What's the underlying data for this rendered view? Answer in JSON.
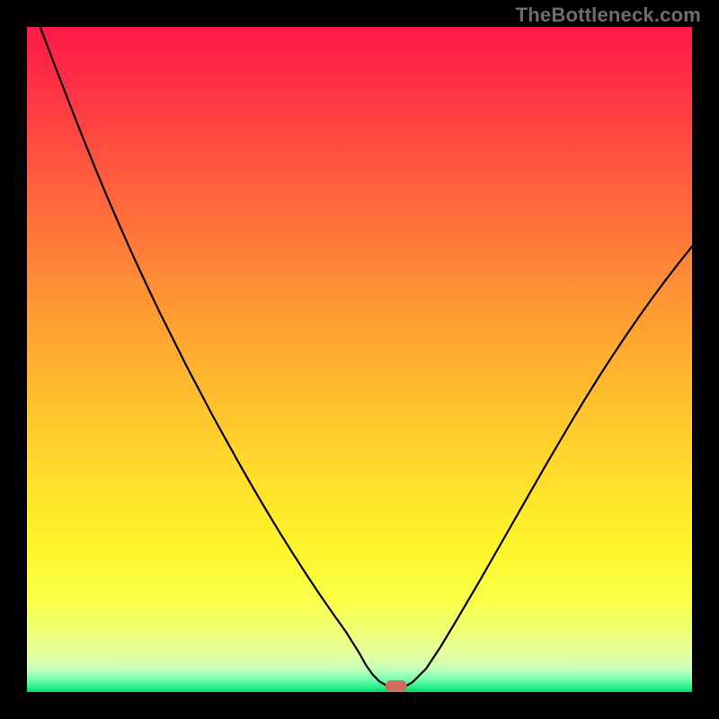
{
  "watermark": "TheBottleneck.com",
  "chart_data": {
    "type": "line",
    "title": "",
    "xlabel": "",
    "ylabel": "",
    "xlim": [
      0,
      100
    ],
    "ylim": [
      0,
      100
    ],
    "x": [
      0,
      2,
      4,
      6,
      8,
      10,
      12,
      14,
      16,
      18,
      20,
      22,
      24,
      26,
      28,
      30,
      32,
      34,
      36,
      38,
      40,
      42,
      44,
      46,
      48,
      50,
      51,
      52,
      53,
      54,
      55,
      56,
      57,
      58,
      60,
      62,
      64,
      66,
      68,
      70,
      72,
      74,
      76,
      78,
      80,
      82,
      84,
      86,
      88,
      90,
      92,
      94,
      96,
      98,
      100
    ],
    "values": [
      null,
      100,
      94.7,
      89.5,
      84.4,
      79.4,
      74.6,
      70.0,
      65.5,
      61.2,
      57.0,
      53.0,
      49.0,
      45.2,
      41.4,
      37.8,
      34.2,
      30.7,
      27.3,
      24.0,
      20.8,
      17.7,
      14.7,
      11.8,
      9.0,
      5.8,
      4.0,
      2.6,
      1.6,
      1.0,
      0.9,
      0.9,
      0.9,
      1.5,
      3.5,
      6.5,
      9.8,
      13.2,
      16.6,
      20.1,
      23.6,
      27.1,
      30.6,
      34.1,
      37.5,
      40.9,
      44.2,
      47.4,
      50.5,
      53.5,
      56.4,
      59.2,
      61.9,
      64.5,
      67.0
    ],
    "min_marker": {
      "x": 55.5,
      "y": 0.9,
      "width": 3.2,
      "height": 1.7
    },
    "gradient_stops": [
      {
        "offset": 0.0,
        "color": "#ff1a48"
      },
      {
        "offset": 0.06,
        "color": "#ff2846"
      },
      {
        "offset": 0.14,
        "color": "#ff4142"
      },
      {
        "offset": 0.22,
        "color": "#ff5a3e"
      },
      {
        "offset": 0.3,
        "color": "#ff733a"
      },
      {
        "offset": 0.38,
        "color": "#ff8c36"
      },
      {
        "offset": 0.46,
        "color": "#ffa432"
      },
      {
        "offset": 0.54,
        "color": "#ffba2f"
      },
      {
        "offset": 0.62,
        "color": "#ffcf2d"
      },
      {
        "offset": 0.7,
        "color": "#ffe22b"
      },
      {
        "offset": 0.78,
        "color": "#fff42b"
      },
      {
        "offset": 0.86,
        "color": "#faff46"
      },
      {
        "offset": 0.91,
        "color": "#efff78"
      },
      {
        "offset": 0.945,
        "color": "#e3ffa0"
      },
      {
        "offset": 0.965,
        "color": "#c4ffba"
      },
      {
        "offset": 0.98,
        "color": "#7fffb0"
      },
      {
        "offset": 0.992,
        "color": "#2cf08f"
      },
      {
        "offset": 1.0,
        "color": "#08d75e"
      }
    ]
  }
}
